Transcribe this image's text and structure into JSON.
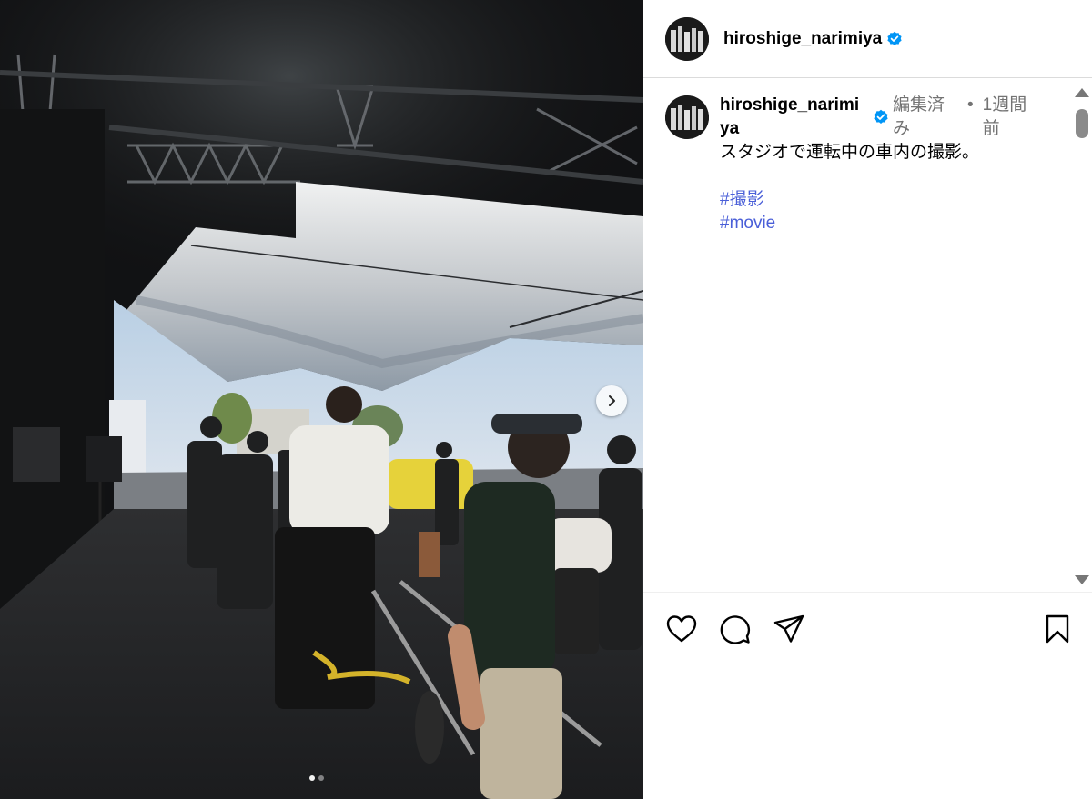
{
  "post": {
    "author": "hiroshige_narimiya",
    "verified": true,
    "caption_user": "hiroshige_narimiya",
    "edited_label": "編集済み",
    "separator": "•",
    "time_label": "1週間前",
    "caption": "スタジオで運転中の車内の撮影。",
    "hashtags": [
      "#撮影",
      "#movie"
    ]
  },
  "carousel": {
    "current": 1,
    "total": 2
  },
  "icons": {
    "verified": "verified-badge-icon",
    "like": "heart-icon",
    "comment": "comment-icon",
    "share": "share-icon",
    "save": "bookmark-icon",
    "next": "chevron-right-icon"
  },
  "colors": {
    "verified": "#0095f6",
    "hashtag": "#4a5fd8",
    "meta": "#737373",
    "divider": "#dbdbdb"
  }
}
